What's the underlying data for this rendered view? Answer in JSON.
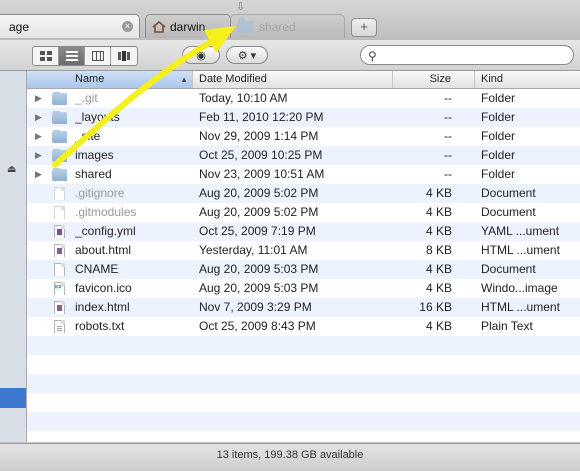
{
  "tabs": {
    "active_label": "age",
    "darwin_label": "darwin",
    "shared_label": "shared",
    "new_tab": "+"
  },
  "toolbar": {
    "view_icons": [
      "icon-view-icon",
      "list-view-icon",
      "column-view-icon",
      "coverflow-view-icon"
    ],
    "quicklook": "◉",
    "action": "⚙ ▾",
    "search_placeholder": ""
  },
  "columns": {
    "name": "Name",
    "date": "Date Modified",
    "size": "Size",
    "kind": "Kind"
  },
  "rows": [
    {
      "name": "_.git",
      "date": "Today, 10:10 AM",
      "size": "--",
      "kind": "Folder",
      "icon": "folder",
      "dim": true,
      "expandable": true
    },
    {
      "name": "_layouts",
      "date": "Feb 11, 2010 12:20 PM",
      "size": "--",
      "kind": "Folder",
      "icon": "folder",
      "dim": false,
      "expandable": true
    },
    {
      "name": "_site",
      "date": "Nov 29, 2009 1:14 PM",
      "size": "--",
      "kind": "Folder",
      "icon": "folder",
      "dim": false,
      "expandable": true
    },
    {
      "name": "images",
      "date": "Oct 25, 2009 10:25 PM",
      "size": "--",
      "kind": "Folder",
      "icon": "folder",
      "dim": false,
      "expandable": true
    },
    {
      "name": "shared",
      "date": "Nov 23, 2009 10:51 AM",
      "size": "--",
      "kind": "Folder",
      "icon": "folder",
      "dim": false,
      "expandable": true
    },
    {
      "name": ".gitignore",
      "date": "Aug 20, 2009 5:02 PM",
      "size": "4 KB",
      "kind": "Document",
      "icon": "doc",
      "dim": true,
      "expandable": false
    },
    {
      "name": ".gitmodules",
      "date": "Aug 20, 2009 5:02 PM",
      "size": "4 KB",
      "kind": "Document",
      "icon": "doc",
      "dim": true,
      "expandable": false
    },
    {
      "name": "_config.yml",
      "date": "Oct 25, 2009 7:19 PM",
      "size": "4 KB",
      "kind": "YAML ...ument",
      "icon": "yml",
      "dim": false,
      "expandable": false
    },
    {
      "name": "about.html",
      "date": "Yesterday, 11:01 AM",
      "size": "8 KB",
      "kind": "HTML ...ument",
      "icon": "html",
      "dim": false,
      "expandable": false
    },
    {
      "name": "CNAME",
      "date": "Aug 20, 2009 5:03 PM",
      "size": "4 KB",
      "kind": "Document",
      "icon": "doc",
      "dim": false,
      "expandable": false
    },
    {
      "name": "favicon.ico",
      "date": "Aug 20, 2009 5:03 PM",
      "size": "4 KB",
      "kind": "Windo...image",
      "icon": "ico",
      "dim": false,
      "expandable": false
    },
    {
      "name": "index.html",
      "date": "Nov 7, 2009 3:29 PM",
      "size": "16 KB",
      "kind": "HTML ...ument",
      "icon": "html",
      "dim": false,
      "expandable": false
    },
    {
      "name": "robots.txt",
      "date": "Oct 25, 2009 8:43 PM",
      "size": "4 KB",
      "kind": "Plain Text",
      "icon": "txt",
      "dim": false,
      "expandable": false
    }
  ],
  "status": "13 items, 199.38 GB available",
  "colors": {
    "arrow": "#f5ef1e",
    "selection": "#3d79cf",
    "stripe": "#edf3fe"
  }
}
